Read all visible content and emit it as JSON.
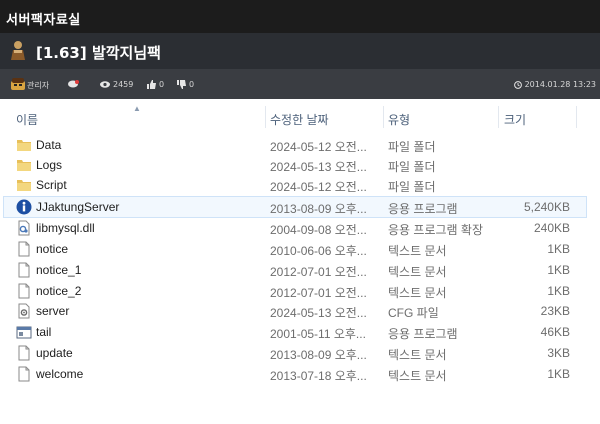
{
  "site": {
    "section_title": "서버팩자료실"
  },
  "post": {
    "title": "[1.63] 발깍지님팩",
    "author": "관리자",
    "views": "2459",
    "likes": "0",
    "dislikes": "0",
    "timestamp": "2014.01.28 13:23"
  },
  "explorer": {
    "columns": {
      "name": "이름",
      "date": "수정한 날짜",
      "type": "유형",
      "size": "크기"
    },
    "files": [
      {
        "name": "Data",
        "date": "2024-05-12 오전...",
        "type": "파일 폴더",
        "size": "",
        "icon": "folder-icon"
      },
      {
        "name": "Logs",
        "date": "2024-05-13 오전...",
        "type": "파일 폴더",
        "size": "",
        "icon": "folder-icon"
      },
      {
        "name": "Script",
        "date": "2024-05-12 오전...",
        "type": "파일 폴더",
        "size": "",
        "icon": "folder-icon"
      },
      {
        "name": "JJaktungServer",
        "date": "2013-08-09 오후...",
        "type": "응용 프로그램",
        "size": "5,240KB",
        "icon": "info-app-icon"
      },
      {
        "name": "libmysql.dll",
        "date": "2004-09-08 오전...",
        "type": "응용 프로그램 확장",
        "size": "240KB",
        "icon": "dll-icon"
      },
      {
        "name": "notice",
        "date": "2010-06-06 오후...",
        "type": "텍스트 문서",
        "size": "1KB",
        "icon": "document-icon"
      },
      {
        "name": "notice_1",
        "date": "2012-07-01 오전...",
        "type": "텍스트 문서",
        "size": "1KB",
        "icon": "document-icon"
      },
      {
        "name": "notice_2",
        "date": "2012-07-01 오전...",
        "type": "텍스트 문서",
        "size": "1KB",
        "icon": "document-icon"
      },
      {
        "name": "server",
        "date": "2024-05-13 오전...",
        "type": "CFG 파일",
        "size": "23KB",
        "icon": "config-icon"
      },
      {
        "name": "tail",
        "date": "2001-05-11 오후...",
        "type": "응용 프로그램",
        "size": "46KB",
        "icon": "app-window-icon"
      },
      {
        "name": "update",
        "date": "2013-08-09 오후...",
        "type": "텍스트 문서",
        "size": "3KB",
        "icon": "document-icon"
      },
      {
        "name": "welcome",
        "date": "2013-07-18 오후...",
        "type": "텍스트 문서",
        "size": "1KB",
        "icon": "document-icon"
      }
    ]
  },
  "colors": {
    "topbar": "#1c1c1c",
    "titlebar": "#2b2e33",
    "metabar": "#3a3d42",
    "folder": "#e8c05a",
    "selection": "#f2f8fe"
  }
}
